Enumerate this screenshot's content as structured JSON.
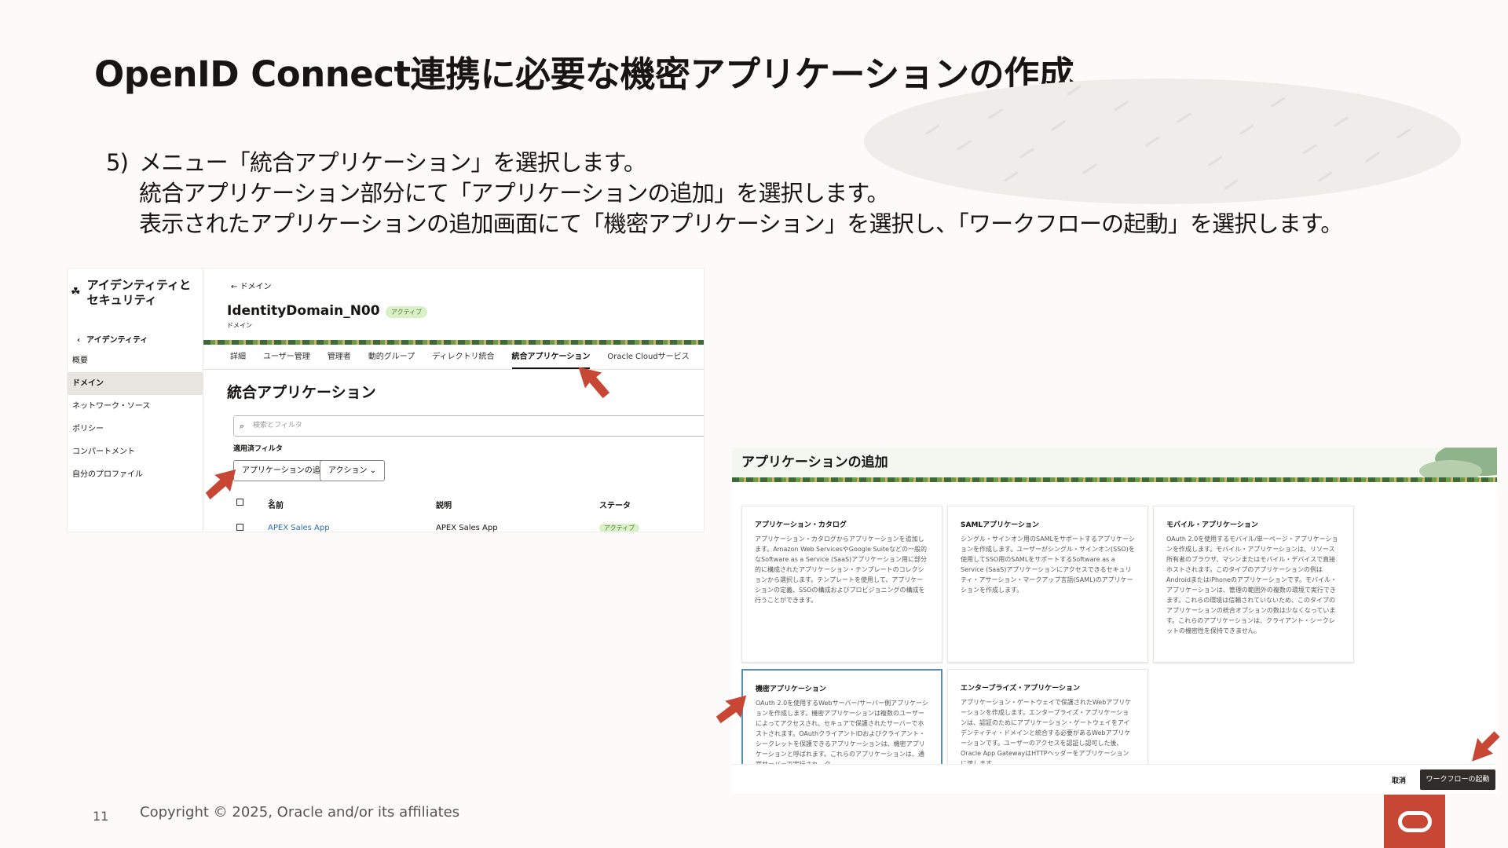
{
  "slide": {
    "title": "OpenID Connect連携に必要な機密アプリケーションの作成",
    "step_number": "5)",
    "step_lines": [
      "メニュー「統合アプリケーション」を選択します。",
      "統合アプリケーション部分にて「アプリケーションの追加」を選択します。",
      "表示されたアプリケーションの追加画面にて「機密アプリケーション」を選択し、「ワークフローの起動」を選択します。"
    ],
    "page_number": "11",
    "copyright": "Copyright © 2025, Oracle and/or its affiliates"
  },
  "colors": {
    "arrow": "#c74634",
    "oracle_red": "#c74634",
    "dark_button": "#312d2a",
    "selected_border": "#5e8fa8"
  },
  "screenshot1": {
    "sidebar": {
      "title": "アイデンティティと\nセキュリティ",
      "title_icon": "identity-icon",
      "back_label": "アイデンティティ",
      "items": [
        {
          "label": "概要",
          "active": false
        },
        {
          "label": "ドメイン",
          "active": true
        },
        {
          "label": "ネットワーク・ソース",
          "active": false
        },
        {
          "label": "ポリシー",
          "active": false
        },
        {
          "label": "コンパートメント",
          "active": false
        },
        {
          "label": "自分のプロファイル",
          "active": false
        }
      ]
    },
    "breadcrumb": "ドメイン",
    "domain_name": "IdentityDomain_N00",
    "domain_status": "アクティブ",
    "domain_sub": "ドメイン",
    "tabs": [
      {
        "label": "詳細",
        "active": false
      },
      {
        "label": "ユーザー管理",
        "active": false
      },
      {
        "label": "管理者",
        "active": false
      },
      {
        "label": "動的グループ",
        "active": false
      },
      {
        "label": "ディレクトリ統合",
        "active": false
      },
      {
        "label": "統合アプリケーション",
        "active": true
      },
      {
        "label": "Oracle Cloudサービス",
        "active": false
      }
    ],
    "section_title": "統合アプリケーション",
    "search_placeholder": "検索とフィルタ",
    "filter_label": "適用済フィルタ",
    "add_button": "アプリケーションの追加",
    "action_button": "アクション",
    "table_headers": [
      "名前",
      "説明",
      "ステータ"
    ],
    "rows": [
      {
        "name": "APEX Sales App",
        "description": "APEX Sales App",
        "status": "アクティブ"
      }
    ]
  },
  "screenshot2": {
    "title": "アプリケーションの追加",
    "cards": [
      {
        "title": "アプリケーション・カタログ",
        "description": "アプリケーション・カタログからアプリケーションを追加します。Amazon Web ServicesやGoogle Suiteなどの一般的なSoftware as a Service (SaaS)アプリケーション用に部分的に構成されたアプリケーション・テンプレートのコレクションから選択します。テンプレートを使用して、アプリケーションの定義、SSOの構成およびプロビジョニングの構成を行うことができます。",
        "selected": false
      },
      {
        "title": "SAMLアプリケーション",
        "description": "シングル・サインオン用のSAMLをサポートするアプリケーションを作成します。ユーザーがシングル・サインオン(SSO)を使用してSSO用のSAMLをサポートするSoftware as a Service (SaaS)アプリケーションにアクセスできるセキュリティ・アサーション・マークアップ言語(SAML)のアプリケーションを作成します。",
        "selected": false
      },
      {
        "title": "モバイル・アプリケーション",
        "description": "OAuth 2.0を使用するモバイル/単一ページ・アプリケーションを作成します。モバイル・アプリケーションは、リソース所有者のブラウザ、マシンまたはモバイル・デバイスで直接ホストされます。このタイプのアプリケーションの例はAndroidまたはiPhoneのアプリケーションです。モバイル・アプリケーションは、管理の範囲外の複数の環境で実行できます。これらの環境は信頼されていないため、このタイプのアプリケーションの統合オプションの数は少なくなっています。これらのアプリケーションは、クライアント・シークレットの機密性を保持できません。",
        "selected": false
      },
      {
        "title": "機密アプリケーション",
        "description": "OAuth 2.0を使用するWebサーバー/サーバー側アプリケーションを作成します。機密アプリケーションは複数のユーザーによってアクセスされ、セキュアで保護されたサーバーでホストされます。OAuthクライアントIDおよびクライアント・シークレットを保護できるアプリケーションは、機密アプリケーションと呼ばれます。これらのアプリケーションは、通常サーバーで実行され、ク",
        "selected": true
      },
      {
        "title": "エンタープライズ・アプリケーション",
        "description": "アプリケーション・ゲートウェイで保護されたWebアプリケーションを作成します。エンタープライズ・アプリケーションは、認証のためにアプリケーション・ゲートウェイをアイデンティティ・ドメインと統合する必要があるWebアプリケーションです。ユーザーのアクセスを認証し認可した後、Oracle App GatewayはHTTPヘッダーをアプリケーションに渡します。",
        "selected": false
      }
    ],
    "cancel_button": "取消",
    "launch_button": "ワークフローの起動"
  }
}
